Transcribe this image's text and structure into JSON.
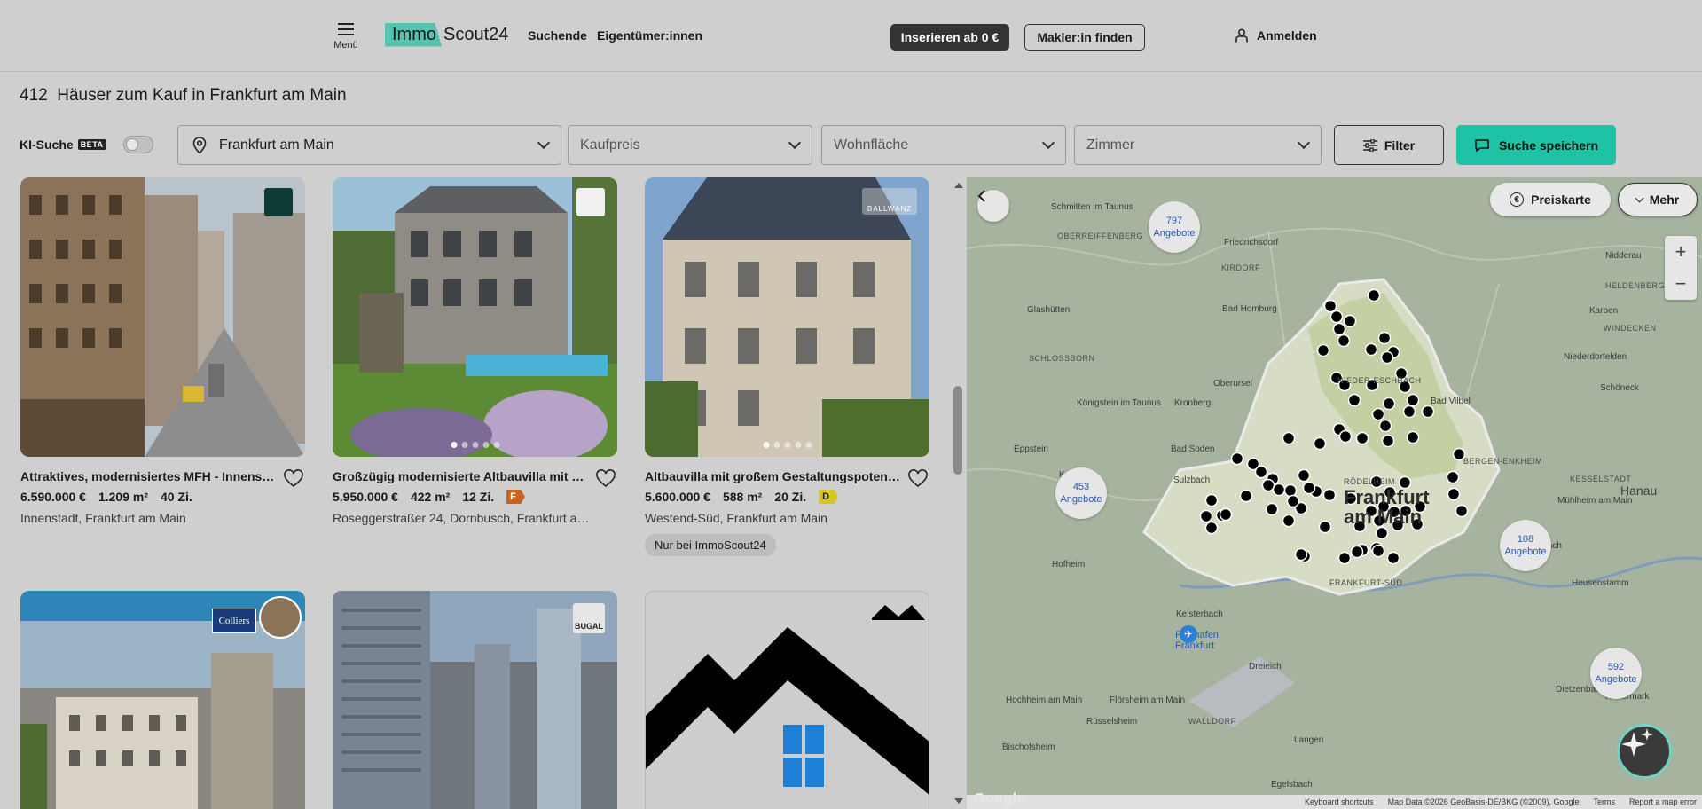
{
  "header": {
    "menu_label": "Menü",
    "logo_part1": "Immo",
    "logo_part2": "Scout24",
    "nav_search": "Suchende",
    "nav_owners": "Eigentümer:innen",
    "cta_publish": "Inserieren ab 0 €",
    "cta_agent": "Makler:in finden",
    "login": "Anmelden"
  },
  "results": {
    "count": "412",
    "title": "Häuser zum Kauf in Frankfurt am Main"
  },
  "filters": {
    "ki_label": "KI-Suche",
    "ki_badge": "BETA",
    "location_value": "Frankfurt am Main",
    "price_placeholder": "Kaufpreis",
    "area_placeholder": "Wohnfläche",
    "rooms_placeholder": "Zimmer",
    "filter_button": "Filter",
    "save_button": "Suche speichern"
  },
  "listings": [
    {
      "title": "Attraktives, modernisiertes MFH - Innenstadt...",
      "price": "6.590.000 €",
      "area": "1.209 m²",
      "rooms": "40 Zi.",
      "address": "Innenstadt, Frankfurt am Main",
      "energy": "",
      "tag": ""
    },
    {
      "title": "Großzügig modernisierte Altbauvilla mit Gar...",
      "price": "5.950.000 €",
      "area": "422 m²",
      "rooms": "12 Zi.",
      "address": "Roseggerstraßer 24, Dornbusch, Frankfurt am ...",
      "energy": "F",
      "tag": ""
    },
    {
      "title": "Altbauvilla mit großem Gestaltungspotenzial...",
      "price": "5.600.000 €",
      "area": "588 m²",
      "rooms": "20 Zi.",
      "address": "Westend-Süd, Frankfurt am Main",
      "energy": "D",
      "tag": "Nur bei ImmoScout24"
    }
  ],
  "agent_logos": {
    "colliers": "Colliers",
    "bugal": "BUGAL",
    "ballwanz": "BALLWANZ"
  },
  "map": {
    "price_map_button": "Preiskarte",
    "more_button": "Mehr",
    "city_label_1": "Frankfurt",
    "city_label_2": "am Main",
    "clusters": [
      {
        "count": "797",
        "label": "Angebote"
      },
      {
        "count": "453",
        "label": "Angebote"
      },
      {
        "count": "108",
        "label": "Angebote"
      },
      {
        "count": "592",
        "label": "Angebote"
      }
    ],
    "places": [
      "Schmitten im Taunus",
      "Friedrichsdorf",
      "Nidderau",
      "OBERREIFFENBERG",
      "KIRDORF",
      "HELDENBERGEN",
      "Karben",
      "Glashütten",
      "Bad Homburg",
      "WINDECKEN",
      "Niederdorfelden",
      "SCHLOSSBORN",
      "Oberursel",
      "NIEDER-ESCHBACH",
      "Schöneck",
      "Königstein im Taunus",
      "Kronberg",
      "Bad Vilbel",
      "Eppstein",
      "Bad Soden",
      "BERGEN-ENKHEIM",
      "Kelkheim",
      "Sulzbach",
      "RÖDELHEIM",
      "KESSELSTADT",
      "Hanau",
      "Hofheim",
      "Offenbach",
      "Mühlheim am Main",
      "Kelsterbach",
      "FRANKFURT-SÜD",
      "Heusenstamm",
      "Flughafen Frankfurt",
      "Hochheim am Main",
      "Flörsheim am Main",
      "WALLDORF",
      "Dreieich",
      "Dietzenbach",
      "Rödermark",
      "Rüsselsheim",
      "Langen",
      "Bischofsheim",
      "Egelsbach"
    ],
    "attribution": [
      "Keyboard shortcuts",
      "Map Data ©2026 GeoBasis-DE/BKG (©2009), Google",
      "Terms",
      "Report a map error"
    ],
    "google": "Google"
  },
  "colors": {
    "accent": "#1ec3a6",
    "logo": "#55c3b0",
    "dark": "#333333"
  }
}
